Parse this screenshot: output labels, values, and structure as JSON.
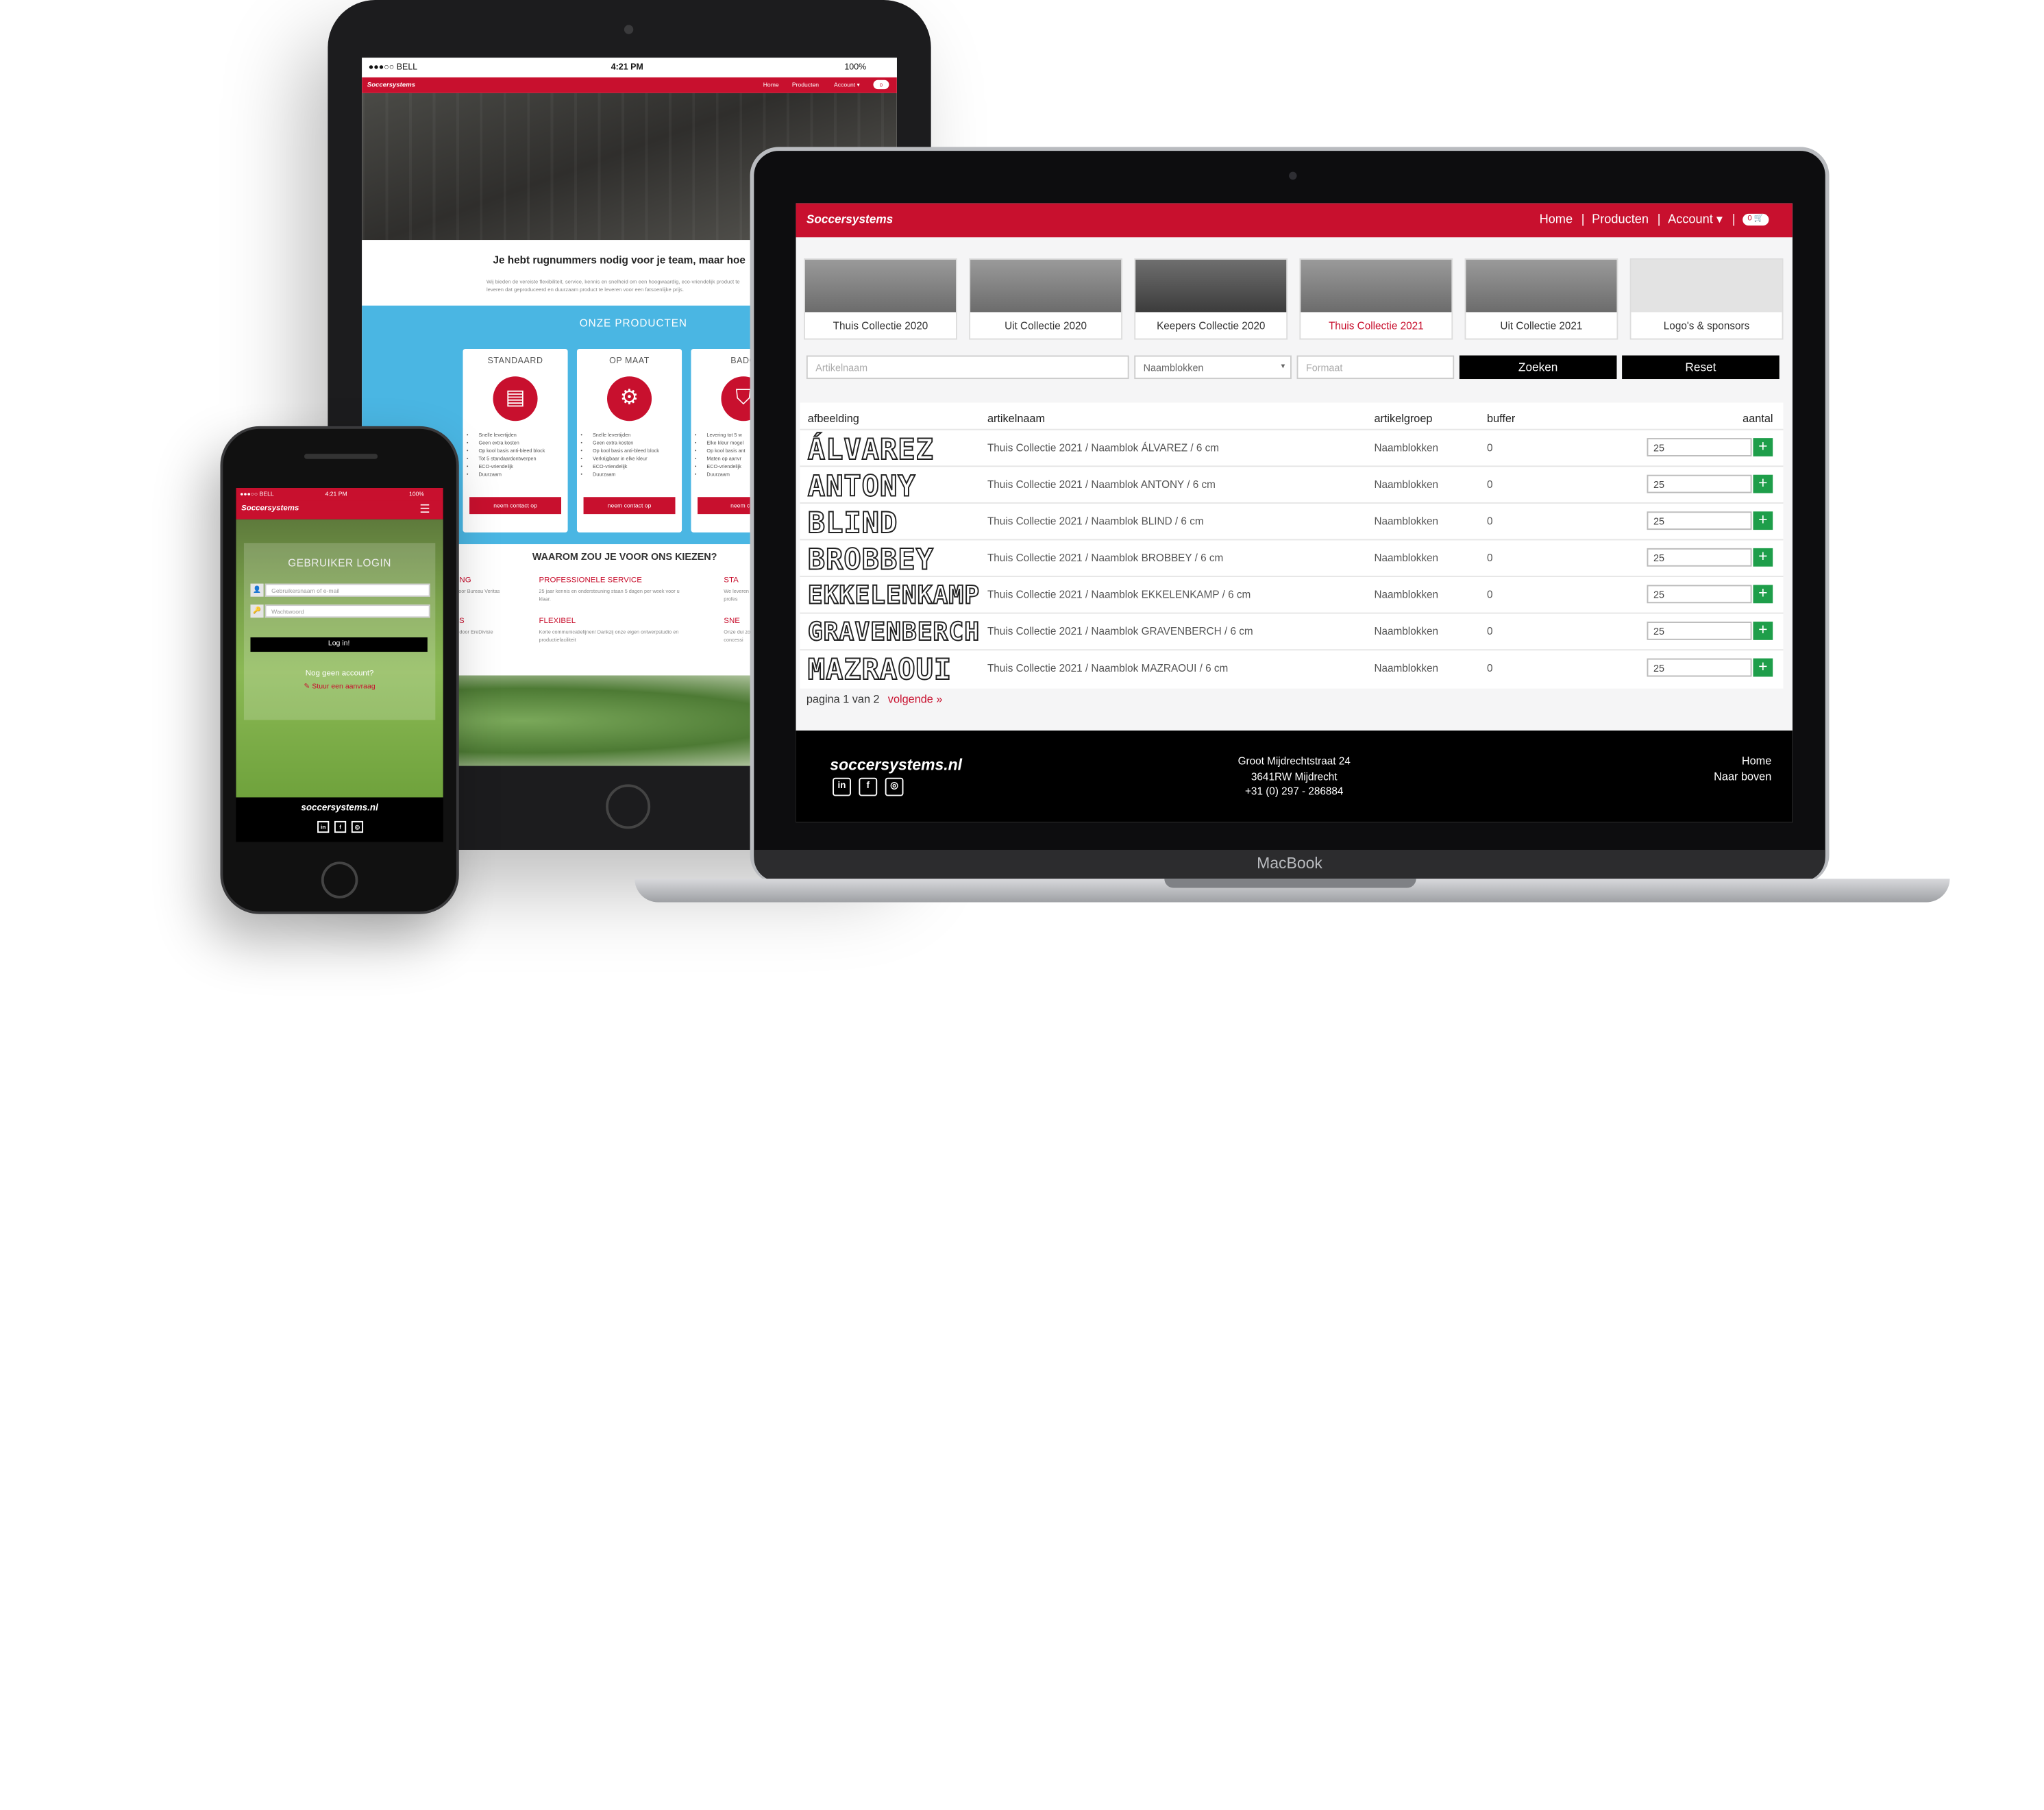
{
  "tablet": {
    "status": {
      "carrier": "●●●○○ BELL",
      "time": "4:21 PM",
      "battery": "100%"
    },
    "nav": {
      "logo": "Soccersystems",
      "home": "Home",
      "products": "Producten",
      "account": "Account ▾",
      "cart": "0"
    },
    "headline": "Je hebt rugnummers nodig voor je team, maar hoe",
    "intro": "Wij bieden de vereiste flexibiliteit, service, kennis en snelheid om een hoogwaardig, eco-vriendelijk product te leveren dat geproduceerd en duurzaam product te leveren voor een fatsoenlijke prijs.",
    "products_title": "ONZE PRODUCTEN",
    "products": [
      {
        "title": "STANDAARD",
        "icon": "shop-icon",
        "glyph": "▤",
        "features": [
          "Snelle levertijden",
          "Geen extra kosten",
          "Op kool basis anti-bleed block",
          "Tot 5 standaardontwerpen",
          "ECO-vriendelijk",
          "Duurzaam"
        ],
        "button": "neem contact op"
      },
      {
        "title": "OP MAAT",
        "icon": "gear-icon",
        "glyph": "⚙",
        "features": [
          "Snelle levertijden",
          "Geen extra kosten",
          "Op kool basis anti-bleed block",
          "Verkrijgbaar in elke kleur",
          "ECO-vriendelijk",
          "Duurzaam"
        ],
        "button": "neem contact op"
      },
      {
        "title": "BADG",
        "icon": "shield-icon",
        "glyph": "⛉",
        "features": [
          "Levering tot 5 w",
          "Elke kleur mogel",
          "Op kool basis ant",
          "Maten op aanvr",
          "ECO-vriendelijk",
          "Duurzaam"
        ],
        "button": "neem con"
      }
    ],
    "why_title": "WAAROM ZOU JE VOOR ONS KIEZEN?",
    "why": [
      {
        "title": "URING",
        "text": "uurt door Bureau Veritas"
      },
      {
        "title": "PROFESSIONELE SERVICE",
        "text": "25 jaar kennis en ondersteuning staan 5 dagen per week voor u klaar."
      },
      {
        "title": "STA",
        "text": "We leveren van profes"
      },
      {
        "title": "RO'S",
        "text": "bruikt door EreDivisie"
      },
      {
        "title": "FLEXIBEL",
        "text": "Korte communicatielijnen! Dankzij onze eigen ontwerpstudio en productiefaciliteit"
      },
      {
        "title": "SNE",
        "text": "Onze dui zonder concessi"
      }
    ]
  },
  "laptop": {
    "brand": "MacBook",
    "nav": {
      "logo": "Soccersystems",
      "home": "Home",
      "sep1": "|",
      "products": "Producten",
      "sep2": "|",
      "account": "Account ▾",
      "sep3": "|",
      "cart": "0 🛒"
    },
    "collections": [
      {
        "label": "Thuis Collectie 2020",
        "active": false
      },
      {
        "label": "Uit Collectie 2020",
        "active": false
      },
      {
        "label": "Keepers Collectie 2020",
        "active": false
      },
      {
        "label": "Thuis Collectie 2021",
        "active": true
      },
      {
        "label": "Uit Collectie 2021",
        "active": false
      },
      {
        "label": "Logo's & sponsors",
        "active": false
      }
    ],
    "filters": {
      "article_placeholder": "Artikelnaam",
      "group_select": "Naamblokken",
      "format_placeholder": "Formaat",
      "search_button": "Zoeken",
      "reset_button": "Reset"
    },
    "table": {
      "headers": [
        "afbeelding",
        "artikelnaam",
        "artikelgroep",
        "buffer",
        "aantal"
      ],
      "rows": [
        {
          "image_text": "ÁLVAREZ",
          "article": "Thuis Collectie 2021 / Naamblok ÁLVAREZ / 6 cm",
          "group": "Naamblokken",
          "buffer": "0",
          "qty": "25"
        },
        {
          "image_text": "ANTONY",
          "article": "Thuis Collectie 2021 / Naamblok ANTONY / 6 cm",
          "group": "Naamblokken",
          "buffer": "0",
          "qty": "25"
        },
        {
          "image_text": "BLIND",
          "article": "Thuis Collectie 2021 / Naamblok BLIND / 6 cm",
          "group": "Naamblokken",
          "buffer": "0",
          "qty": "25"
        },
        {
          "image_text": "BROBBEY",
          "article": "Thuis Collectie 2021 / Naamblok BROBBEY / 6 cm",
          "group": "Naamblokken",
          "buffer": "0",
          "qty": "25"
        },
        {
          "image_text": "EKKELENKAMP",
          "article": "Thuis Collectie 2021 / Naamblok EKKELENKAMP / 6 cm",
          "group": "Naamblokken",
          "buffer": "0",
          "qty": "25"
        },
        {
          "image_text": "GRAVENBERCH",
          "article": "Thuis Collectie 2021 / Naamblok GRAVENBERCH / 6 cm",
          "group": "Naamblokken",
          "buffer": "0",
          "qty": "25"
        },
        {
          "image_text": "MAZRAOUI",
          "article": "Thuis Collectie 2021 / Naamblok MAZRAOUI / 6 cm",
          "group": "Naamblokken",
          "buffer": "0",
          "qty": "25"
        }
      ],
      "add_glyph": "+"
    },
    "pagination": {
      "text": "pagina 1 van 2",
      "next": "volgende »"
    },
    "footer": {
      "logo": "soccersystems.nl",
      "social": [
        {
          "icon": "linkedin-icon",
          "glyph": "in"
        },
        {
          "icon": "facebook-icon",
          "glyph": "f"
        },
        {
          "icon": "instagram-icon",
          "glyph": "◎"
        }
      ],
      "address": [
        "Groot Mijdrechtstraat 24",
        "3641RW Mijdrecht",
        "+31 (0) 297 - 286884"
      ],
      "links": [
        "Home",
        "Naar boven"
      ]
    }
  },
  "phone": {
    "status": {
      "carrier": "●●●○○ BELL",
      "time": "4:21 PM",
      "battery": "100%"
    },
    "nav": {
      "logo": "Soccersystems",
      "menu_glyph": "☰"
    },
    "login_title": "GEBRUIKER LOGIN",
    "username_placeholder": "Gebruikersnaam of e-mail",
    "password_placeholder": "Wachtwoord",
    "login_button": "Log in!",
    "no_account": "Nog geen account?",
    "request_link": "✎ Stuur een aanvraag",
    "footer_logo": "soccersystems.nl",
    "social": [
      {
        "icon": "linkedin-icon",
        "glyph": "in"
      },
      {
        "icon": "facebook-icon",
        "glyph": "f"
      },
      {
        "icon": "instagram-icon",
        "glyph": "◎"
      }
    ]
  },
  "colors": {
    "brand_red": "#c8102e",
    "accent_blue": "#4ab6e3",
    "success_green": "#1e9e4a"
  }
}
